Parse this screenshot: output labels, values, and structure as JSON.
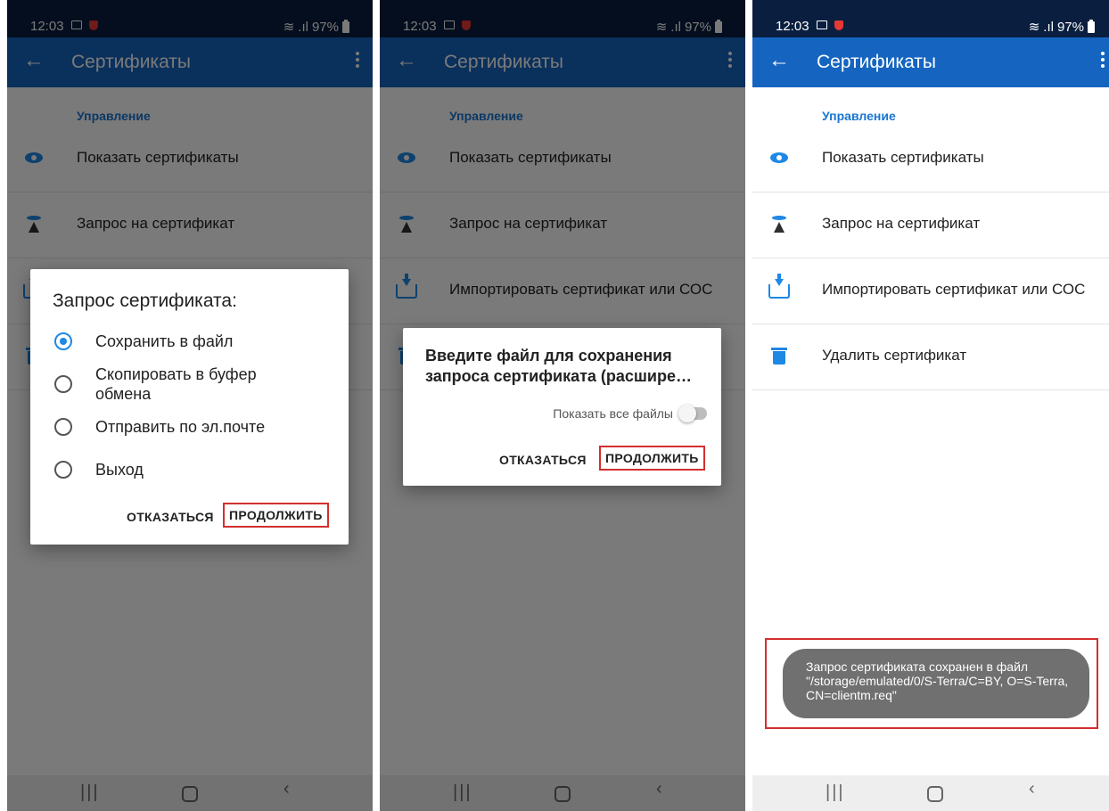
{
  "status": {
    "time": "12:03",
    "battery": "97%"
  },
  "app": {
    "title": "Сертификаты",
    "section_label": "Управление",
    "items": [
      {
        "label": "Показать сертификаты",
        "icon": "eye-icon"
      },
      {
        "label": "Запрос на сертификат",
        "icon": "request-icon"
      },
      {
        "label": "Импортировать сертификат или СОС",
        "icon": "import-icon"
      },
      {
        "label": "Удалить сертификат",
        "icon": "trash-icon"
      }
    ]
  },
  "dialog1": {
    "title": "Запрос сертификата:",
    "options": [
      {
        "label": "Сохранить в файл",
        "selected": true
      },
      {
        "label": "Скопировать в буфер обмена",
        "selected": false
      },
      {
        "label": "Отправить по эл.почте",
        "selected": false
      },
      {
        "label": "Выход",
        "selected": false
      }
    ],
    "cancel": "ОТКАЗАТЬСЯ",
    "continue": "ПРОДОЛЖИТЬ"
  },
  "dialog2": {
    "title": "Введите файл для сохранения запроса сертификата (расшире…",
    "toggle_label": "Показать все файлы",
    "cancel": "ОТКАЗАТЬСЯ",
    "continue": "ПРОДОЛЖИТЬ"
  },
  "toast": {
    "text": "Запрос сертификата сохранен в файл \"/storage/emulated/0/S-Terra/C=BY, O=S-Terra, CN=clientm.req\""
  },
  "colors": {
    "status_bar": "#0a1f3f",
    "app_bar": "#1565c0",
    "accent": "#1e88e5",
    "highlight": "#d32f2f"
  }
}
